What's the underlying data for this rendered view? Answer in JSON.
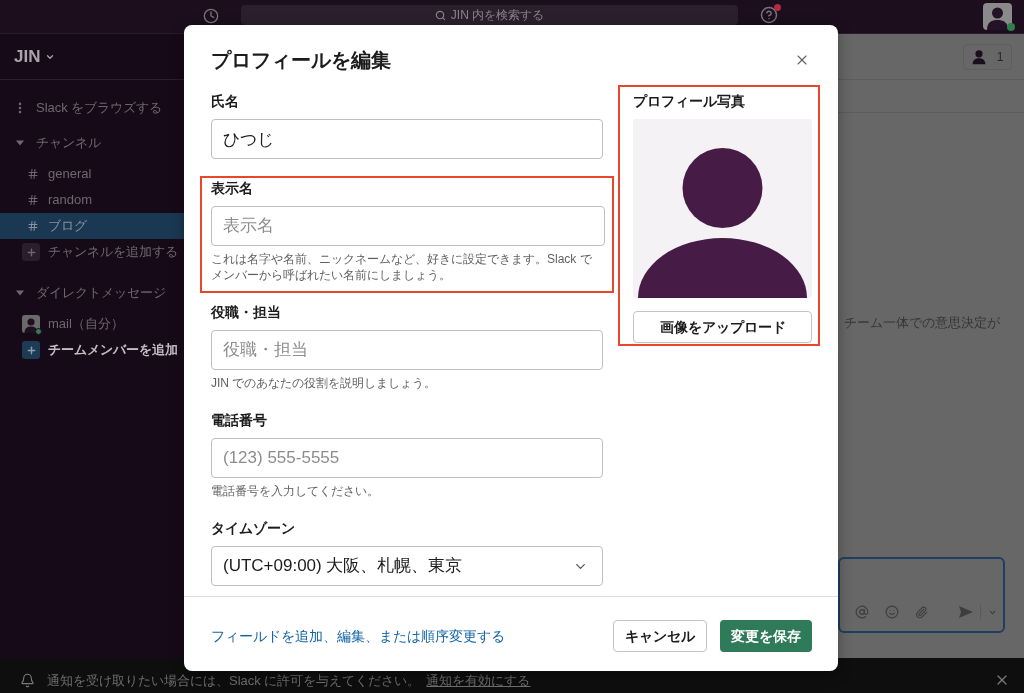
{
  "top_bar": {
    "search": {
      "placeholder": "JIN 内を検索する"
    },
    "help": {
      "has_notification": true
    },
    "user_avatar": {
      "online": true
    }
  },
  "sidebar": {
    "workspace": "JIN",
    "browse": "Slack をブラウズする",
    "sections": [
      {
        "title": "チャンネル",
        "expanded": true,
        "items": [
          {
            "kind": "channel",
            "label": "general",
            "selected": false
          },
          {
            "kind": "channel",
            "label": "random",
            "selected": false
          },
          {
            "kind": "channel",
            "label": "ブログ",
            "selected": true
          },
          {
            "kind": "add",
            "label": "チャンネルを追加する",
            "selected": false
          }
        ]
      },
      {
        "title": "ダイレクトメッセージ",
        "expanded": true,
        "items": [
          {
            "kind": "user",
            "label": "mail（自分）",
            "selected": false,
            "online": true
          },
          {
            "kind": "invite",
            "label": "チームメンバーを追加",
            "selected": false
          }
        ]
      }
    ]
  },
  "channel_header": {
    "member_count": "1"
  },
  "messages": {
    "excerpt": "チーム一体での意思決定が"
  },
  "notification_bar": {
    "message": "通知を受け取りたい場合には、Slack に許可を与えてください。",
    "link": "通知を有効にする"
  },
  "modal": {
    "title": "プロフィールを編集",
    "fields": [
      {
        "kind": "text",
        "label": "氏名",
        "value": "ひつじ",
        "highlighted": false
      },
      {
        "kind": "text",
        "label": "表示名",
        "placeholder": "表示名",
        "hint": "これは名字や名前、ニックネームなど、好きに設定できます。Slack でメンバーから呼ばれたい名前にしましょう。",
        "highlighted": true
      },
      {
        "kind": "text",
        "label": "役職・担当",
        "placeholder": "役職・担当",
        "hint": "JIN でのあなたの役割を説明しましょう。",
        "highlighted": false
      },
      {
        "kind": "text",
        "label": "電話番号",
        "placeholder": "(123) 555-5555",
        "hint": "電話番号を入力してください。",
        "highlighted": false
      },
      {
        "kind": "select",
        "label": "タイムゾーン",
        "value": "(UTC+09:00) 大阪、札幌、東京",
        "highlighted": false
      }
    ],
    "photo": {
      "label": "プロフィール写真",
      "button": "画像をアップロード",
      "highlighted": true
    },
    "footer": {
      "link": "フィールドを追加、編集、または順序変更する",
      "buttons": [
        {
          "kind": "secondary",
          "label": "キャンセル"
        },
        {
          "kind": "primary",
          "label": "変更を保存"
        }
      ]
    }
  }
}
